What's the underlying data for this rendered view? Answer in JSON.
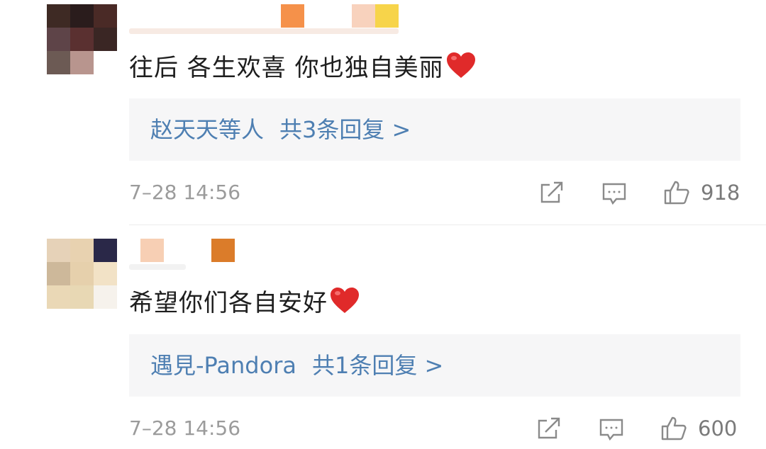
{
  "comments": [
    {
      "text": "往后 各生欢喜 你也独自美丽",
      "reply": {
        "users": "赵天天等人",
        "count_label": "共3条回复 >"
      },
      "time": "7–28 14:56",
      "likes": "918"
    },
    {
      "text": "希望你们各自安好",
      "reply": {
        "users": "遇見-Pandora",
        "count_label": "共1条回复 >"
      },
      "time": "7–28 14:56",
      "likes": "600"
    }
  ],
  "icons": {
    "repost": "share-icon",
    "comment": "comment-icon",
    "like": "thumbs-up-icon",
    "emoji": "heart-emoji"
  },
  "colors": {
    "link": "#4e7fb2",
    "meta": "#9b9b9b",
    "reply_bg": "#f6f6f7",
    "heart": "#e02a2a"
  }
}
